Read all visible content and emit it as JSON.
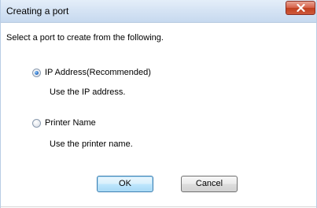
{
  "window": {
    "title": "Creating a port",
    "close_icon": "close-icon"
  },
  "dialog": {
    "prompt": "Select a port to create from the following.",
    "options": [
      {
        "label": "IP Address(Recommended)",
        "description": "Use the IP address.",
        "selected": true
      },
      {
        "label": "Printer Name",
        "description": "Use the printer name.",
        "selected": false
      }
    ],
    "ok_label": "OK",
    "cancel_label": "Cancel"
  }
}
